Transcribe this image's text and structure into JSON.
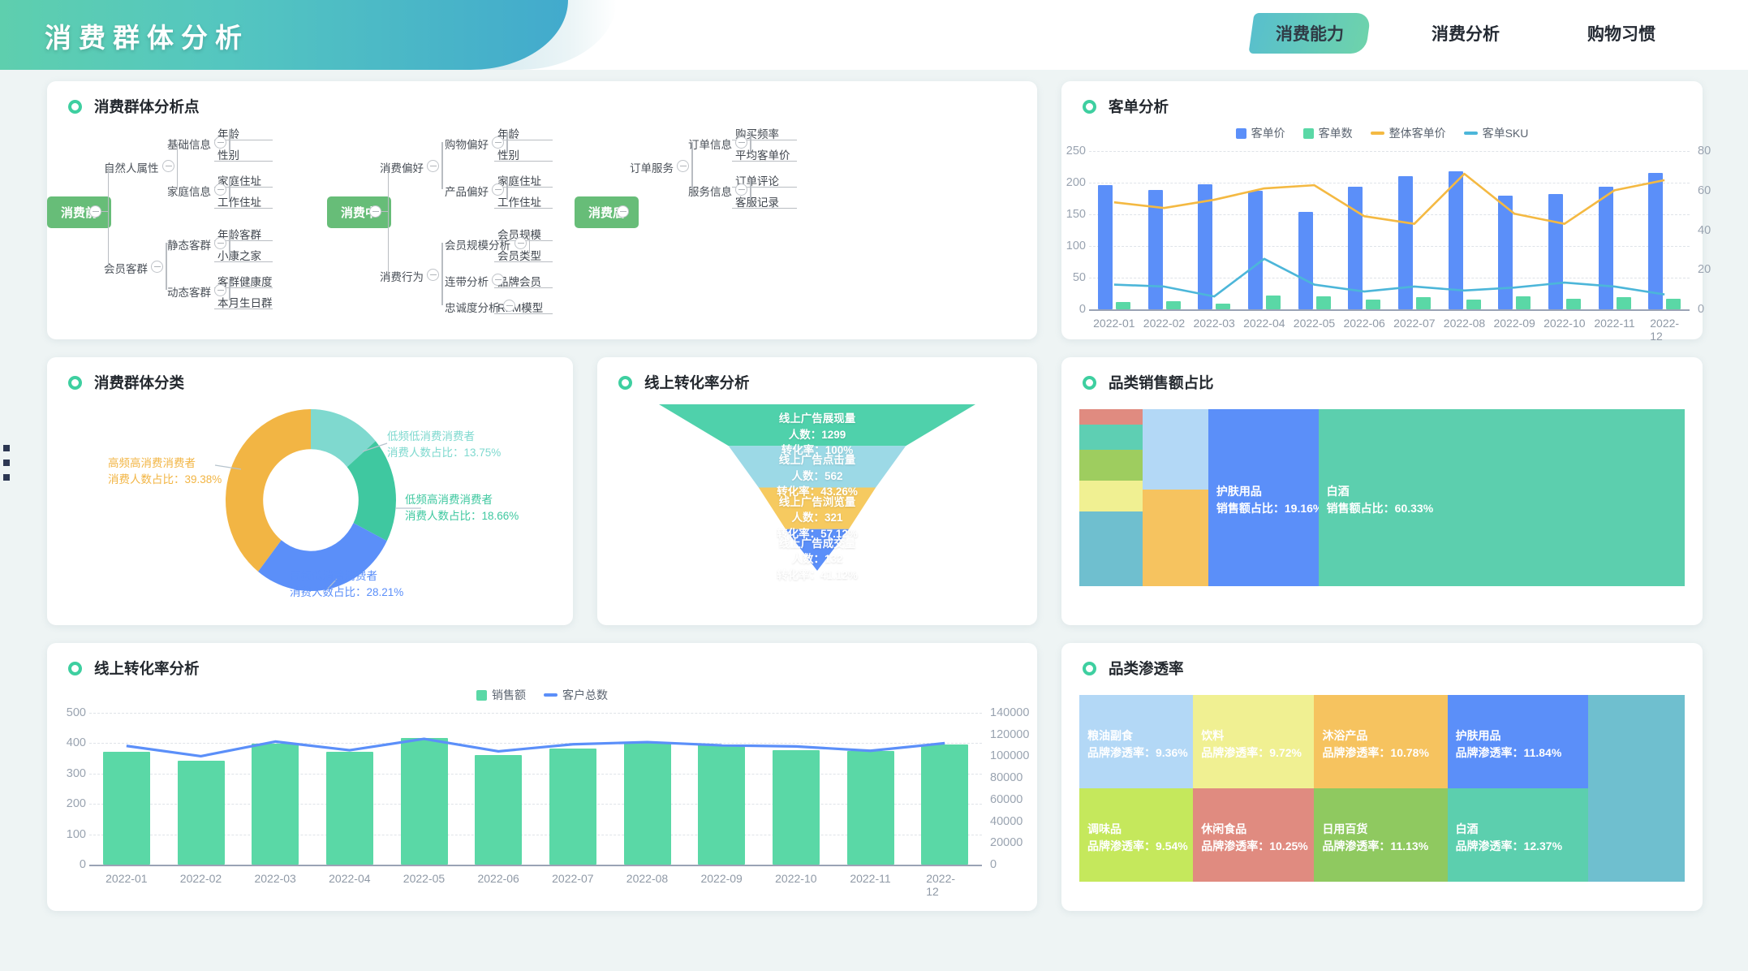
{
  "header": {
    "title": "消费群体分析",
    "nav": [
      {
        "label": "消费能力",
        "active": true
      },
      {
        "label": "消费分析",
        "active": false
      },
      {
        "label": "购物习惯",
        "active": false
      }
    ]
  },
  "panels": {
    "mindmap_title": "消费群体分析点",
    "customer_order_title": "客单分析",
    "segment_title": "消费群体分类",
    "funnel_title": "线上转化率分析",
    "category_sales_title": "品类销售额占比",
    "sales_title": "线上转化率分析",
    "penetration_title": "品类渗透率"
  },
  "mindmap": {
    "branches": [
      {
        "root": "消费前",
        "groups": [
          {
            "name": "自然人属性",
            "subs": [
              {
                "name": "基础信息",
                "leaves": [
                  "年龄",
                  "性别"
                ]
              },
              {
                "name": "家庭信息",
                "leaves": [
                  "家庭住址",
                  "工作住址"
                ]
              }
            ]
          },
          {
            "name": "会员客群",
            "subs": [
              {
                "name": "静态客群",
                "leaves": [
                  "年龄客群",
                  "小康之家"
                ]
              },
              {
                "name": "动态客群",
                "leaves": [
                  "客群健康度",
                  "本月生日群"
                ]
              }
            ]
          }
        ]
      },
      {
        "root": "消费中",
        "groups": [
          {
            "name": "消费偏好",
            "subs": [
              {
                "name": "购物偏好",
                "leaves": [
                  "年龄",
                  "性别"
                ]
              },
              {
                "name": "产品偏好",
                "leaves": [
                  "家庭住址",
                  "工作住址"
                ]
              }
            ]
          },
          {
            "name": "消费行为",
            "subs": [
              {
                "name": "会员规模分析",
                "leaves": [
                  "会员规模",
                  "会员类型"
                ]
              },
              {
                "name": "连带分析",
                "leaves": [
                  "品牌会员"
                ]
              },
              {
                "name": "忠诚度分析",
                "leaves": [
                  "RFM模型"
                ]
              }
            ]
          }
        ]
      },
      {
        "root": "消费后",
        "groups": [
          {
            "name": "订单服务",
            "subs": [
              {
                "name": "订单信息",
                "leaves": [
                  "购买频率",
                  "平均客单价"
                ]
              },
              {
                "name": "服务信息",
                "leaves": [
                  "订单评论",
                  "客服记录"
                ]
              }
            ]
          }
        ]
      }
    ]
  },
  "chart_data": [
    {
      "id": "customer_order",
      "type": "bar",
      "title": "客单分析",
      "categories": [
        "2022-01",
        "2022-02",
        "2022-03",
        "2022-04",
        "2022-05",
        "2022-06",
        "2022-07",
        "2022-08",
        "2022-09",
        "2022-10",
        "2022-11",
        "2022-12"
      ],
      "series": [
        {
          "name": "客单价",
          "type": "bar",
          "axis": "left",
          "color": "#5b8ff9",
          "values": [
            196,
            188,
            198,
            187,
            154,
            193,
            210,
            218,
            180,
            182,
            193,
            215
          ]
        },
        {
          "name": "客单数",
          "type": "bar",
          "axis": "right",
          "color": "#5ad8a6",
          "values": [
            3.5,
            4.0,
            3.0,
            7.0,
            6.5,
            5.0,
            6.0,
            5.0,
            6.5,
            5.5,
            6.0,
            5.5
          ]
        },
        {
          "name": "整体客单价",
          "type": "line",
          "axis": "left",
          "color": "#f4b942",
          "values": [
            169,
            160,
            173,
            191,
            196,
            147,
            135,
            214,
            151,
            135,
            188,
            204
          ]
        },
        {
          "name": "客单SKU",
          "type": "line",
          "axis": "right",
          "color": "#4cb6d9",
          "values": [
            12.5,
            11.5,
            6.5,
            25.5,
            12.5,
            9.0,
            11.5,
            9.5,
            11.0,
            13.5,
            11.5,
            7.5
          ]
        }
      ],
      "ylabel": "",
      "xlabel": "",
      "ylim": [
        0,
        250
      ],
      "y2lim": [
        0,
        80
      ],
      "yticks": [
        0,
        50,
        100,
        150,
        200,
        250
      ],
      "y2ticks": [
        0,
        20,
        40,
        60,
        80
      ],
      "grid": true,
      "legend_position": "top"
    },
    {
      "id": "segment_donut",
      "type": "pie",
      "title": "消费群体分类",
      "labels": [
        "低频低消费消费者",
        "低频高消费消费者",
        "高频低消费消费者",
        "高频高消费消费者"
      ],
      "values": [
        13.75,
        18.66,
        28.21,
        39.38
      ],
      "value_prefix": "消费人数占比：",
      "value_suffix": "%",
      "colors": [
        "#86e0d6",
        "#5ddcb0",
        "#5b8ff9",
        "#fbd159"
      ],
      "display": [
        {
          "name": "低频低消费消费者",
          "value": "消费人数占比：13.75%",
          "color": "#7fd9cf"
        },
        {
          "name": "低频高消费消费者",
          "value": "消费人数占比：18.66%",
          "color": "#3fc8a0"
        },
        {
          "name": "高频低消费消费者",
          "value": "消费人数占比：28.21%",
          "color": "#5b8ff9"
        },
        {
          "name": "高频高消费消费者",
          "value": "消费人数占比：39.38%",
          "color": "#f2b544"
        }
      ]
    },
    {
      "id": "online_funnel",
      "type": "funnel",
      "title": "线上转化率分析",
      "count_label": "人数",
      "rate_label": "转化率",
      "stages": [
        {
          "name": "线上广告展现量",
          "count": 1299,
          "rate": "100%",
          "color": "#4fd1ab"
        },
        {
          "name": "线上广告点击量",
          "count": 562,
          "rate": "43.26%",
          "color": "#9cd9e6"
        },
        {
          "name": "线上广告浏览量",
          "count": 321,
          "rate": "57.12%",
          "color": "#f6ca60"
        },
        {
          "name": "线上广告成交量",
          "count": 132,
          "rate": "41.12%",
          "color": "#5b8ff9"
        }
      ]
    },
    {
      "id": "category_sales",
      "type": "treemap",
      "title": "品类销售额占比",
      "metric_label": "销售额占比",
      "tiles": [
        {
          "name": "白酒",
          "value": "60.33%",
          "color": "#5ccfae",
          "show_label": true
        },
        {
          "name": "护肤用品",
          "value": "19.16%",
          "color": "#5b8ff9",
          "show_label": true
        },
        {
          "name": "",
          "value": "",
          "color": "#b3d8f6",
          "show_label": false
        },
        {
          "name": "",
          "value": "",
          "color": "#f6c35f",
          "show_label": false
        },
        {
          "name": "",
          "value": "",
          "color": "#e08b80",
          "show_label": false
        },
        {
          "name": "",
          "value": "",
          "color": "#5ecfb3",
          "show_label": false
        },
        {
          "name": "",
          "value": "",
          "color": "#9ecd5f",
          "show_label": false
        },
        {
          "name": "",
          "value": "",
          "color": "#f0f092",
          "show_label": false
        },
        {
          "name": "",
          "value": "",
          "color": "#6fbfcf",
          "show_label": false
        }
      ]
    },
    {
      "id": "sales_trend",
      "type": "bar",
      "title": "线上转化率分析",
      "categories": [
        "2022-01",
        "2022-02",
        "2022-03",
        "2022-04",
        "2022-05",
        "2022-06",
        "2022-07",
        "2022-08",
        "2022-09",
        "2022-10",
        "2022-11",
        "2022-12"
      ],
      "series": [
        {
          "name": "销售额",
          "type": "bar",
          "axis": "left",
          "color": "#5ad8a6",
          "values": [
            373,
            342,
            398,
            373,
            416,
            362,
            383,
            404,
            397,
            377,
            375,
            397
          ]
        },
        {
          "name": "客户总数",
          "type": "line",
          "axis": "right",
          "color": "#5b8ff9",
          "values": [
            109500,
            100000,
            113500,
            105500,
            116000,
            104500,
            111000,
            113000,
            110000,
            109000,
            105000,
            112000
          ]
        }
      ],
      "ylim": [
        0,
        500
      ],
      "y2lim": [
        0,
        140000
      ],
      "yticks": [
        0,
        100,
        200,
        300,
        400,
        500
      ],
      "y2ticks": [
        0,
        20000,
        40000,
        60000,
        80000,
        100000,
        120000,
        140000
      ],
      "grid": true,
      "legend_position": "top"
    },
    {
      "id": "penetration",
      "type": "treemap",
      "title": "品类渗透率",
      "metric_label": "品牌渗透率",
      "tiles": [
        {
          "name": "粮油副食",
          "value": "9.36%",
          "color": "#b3d8f6",
          "show_label": true
        },
        {
          "name": "饮料",
          "value": "9.72%",
          "color": "#f0f092",
          "show_label": true
        },
        {
          "name": "沐浴产品",
          "value": "10.78%",
          "color": "#f6c35f",
          "show_label": true
        },
        {
          "name": "护肤用品",
          "value": "11.84%",
          "color": "#5b8ff9",
          "show_label": true
        },
        {
          "name": "调味品",
          "value": "9.54%",
          "color": "#c5e85c",
          "show_label": true
        },
        {
          "name": "休闲食品",
          "value": "10.25%",
          "color": "#e08b80",
          "show_label": true
        },
        {
          "name": "日用百货",
          "value": "11.13%",
          "color": "#8fc960",
          "show_label": true
        },
        {
          "name": "白酒",
          "value": "12.37%",
          "color": "#5ccfae",
          "show_label": true
        },
        {
          "name": "",
          "value": "",
          "color": "#6fbfcf",
          "show_label": false
        }
      ]
    }
  ]
}
